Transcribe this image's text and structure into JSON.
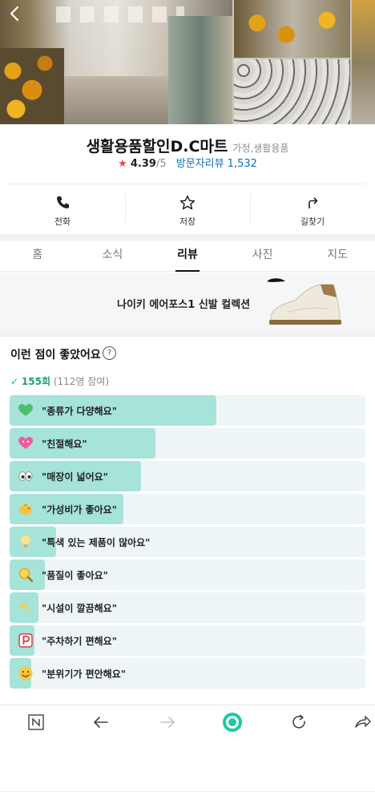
{
  "header": {
    "back_icon": "back-arrow-icon"
  },
  "place": {
    "name": "생활용품할인D.C마트",
    "category": "가정,생활용품",
    "star": "★",
    "rating": "4.39",
    "rating_max": "/5",
    "visitor_reviews": "방문자리뷰 1,532"
  },
  "actions": [
    {
      "label": "전화",
      "icon": "phone-icon"
    },
    {
      "label": "저장",
      "icon": "star-outline-icon"
    },
    {
      "label": "길찾기",
      "icon": "directions-icon"
    }
  ],
  "tabs": [
    "홈",
    "소식",
    "리뷰",
    "사진",
    "지도"
  ],
  "active_tab": "리뷰",
  "ad": {
    "text": "나이키 에어포스1 신발 컬렉션",
    "brand_icon": "nike-swoosh-icon"
  },
  "likes": {
    "title": "이런 점이 좋았어요",
    "help_symbol": "?",
    "check": "✓",
    "count": "155회",
    "participants": "(112명 참여)",
    "fill_color": "#a6e3d8",
    "items": [
      {
        "text": "\"종류가 다양해요\"",
        "icon": "green-heart-icon",
        "share": 0.58
      },
      {
        "text": "\"친절해요\"",
        "icon": "pink-heart-icon",
        "share": 0.41
      },
      {
        "text": "\"매장이 넓어요\"",
        "icon": "eyes-icon",
        "share": 0.37
      },
      {
        "text": "\"가성비가 좋아요\"",
        "icon": "piggy-bank-icon",
        "share": 0.32
      },
      {
        "text": "\"특색 있는 제품이 많아요\"",
        "icon": "lightbulb-icon",
        "share": 0.13
      },
      {
        "text": "\"품질이 좋아요\"",
        "icon": "magnifier-icon",
        "share": 0.1
      },
      {
        "text": "\"시설이 깔끔해요\"",
        "icon": "sparkles-icon",
        "share": 0.08
      },
      {
        "text": "\"주차하기 편해요\"",
        "icon": "parking-icon",
        "share": 0.07
      },
      {
        "text": "\"분위기가 편안해요\"",
        "icon": "smile-face-icon",
        "share": 0.06
      }
    ]
  },
  "browser_bar": {
    "icons": [
      "naver-n-icon",
      "back-arrow-icon",
      "forward-arrow-icon",
      "home-circle-icon",
      "refresh-icon",
      "share-icon"
    ]
  }
}
